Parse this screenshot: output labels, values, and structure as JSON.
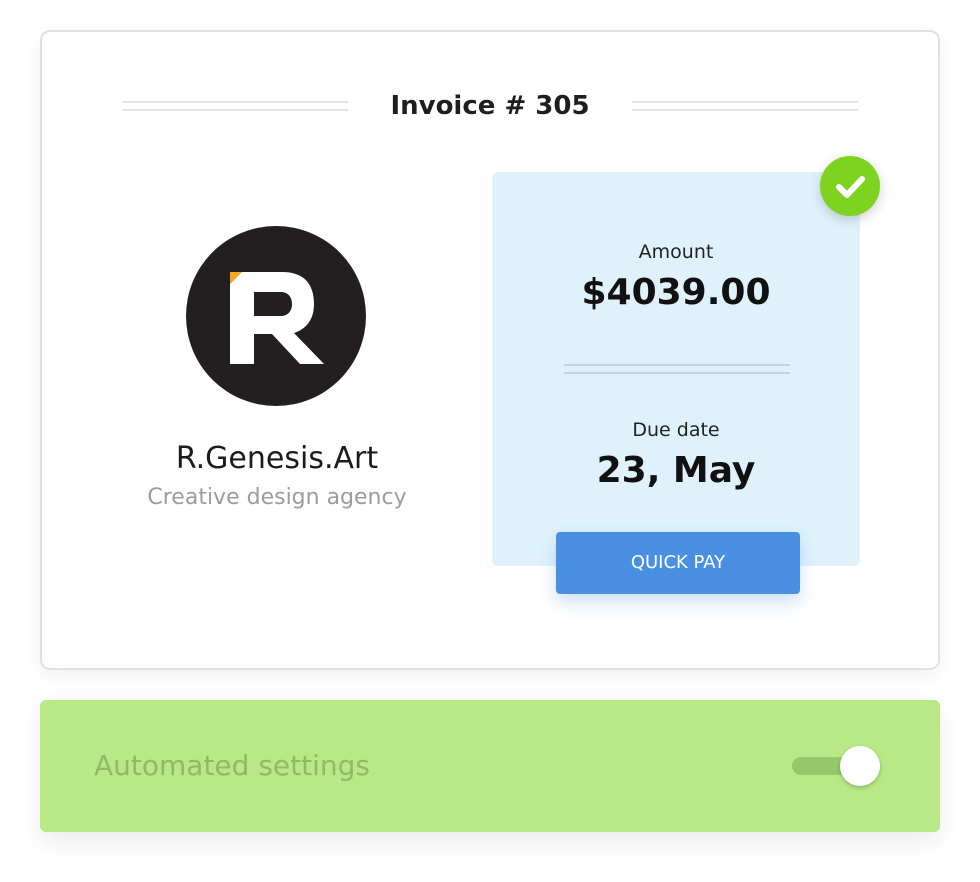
{
  "invoice": {
    "title": "Invoice # 305",
    "company": {
      "name": "R.Genesis.Art",
      "tagline": "Creative design agency",
      "logo": "R",
      "logo_colors": {
        "circle": "#231f20",
        "letter": "#ffffff",
        "accent": "#f5a623"
      }
    },
    "amount_label": "Amount",
    "amount_value": "$4039.00",
    "due_label": "Due date",
    "due_value": "23, May",
    "pay_button": "QUICK PAY",
    "status_icon": "check-icon"
  },
  "settings": {
    "label": "Automated settings",
    "toggle_on": true
  },
  "colors": {
    "accent_blue": "#4a90e2",
    "success_green": "#7ed321",
    "panel_light_blue": "#dff2fb",
    "settings_green": "#b8e986"
  }
}
